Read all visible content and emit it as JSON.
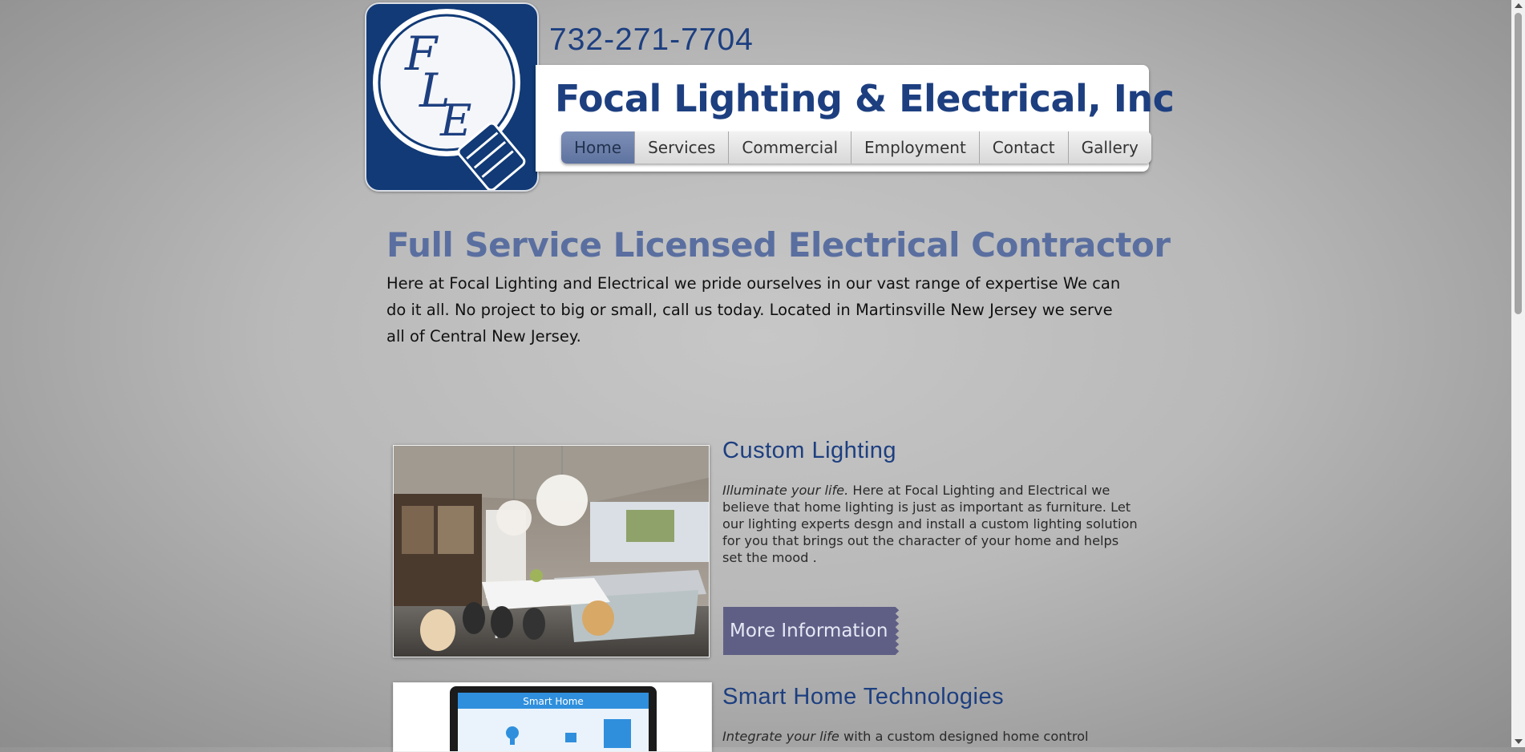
{
  "header": {
    "phone": "732-271-7704",
    "title": "Focal Lighting & Electrical, Inc",
    "logo_initials": [
      "F",
      "L",
      "E"
    ]
  },
  "nav": {
    "items": [
      {
        "label": "Home",
        "active": true
      },
      {
        "label": "Services",
        "active": false
      },
      {
        "label": "Commercial",
        "active": false
      },
      {
        "label": "Employment",
        "active": false
      },
      {
        "label": "Contact",
        "active": false
      },
      {
        "label": "Gallery",
        "active": false
      }
    ]
  },
  "intro": {
    "headline": "Full Service Licensed Electrical Contractor",
    "body": "Here at Focal Lighting and Electrical we pride ourselves in our vast range of expertise We can do it all. No project to big or small, call us today.  Located in Martinsville New Jersey we serve all of Central New Jersey."
  },
  "features": [
    {
      "title": "Custom Lighting",
      "lead": "Illuminate your life.",
      "text": " Here at Focal Lighting and Electrical we believe that home lighting is just as important as furniture. Let our lighting experts desgn and install a custom lighting solution for you that brings out the character of your home and helps set the mood .",
      "button": "More Information"
    },
    {
      "title": "Smart Home Technologies",
      "lead": "Integrate your life",
      "text": " with a custom designed home control",
      "screen_title": "Smart Home"
    }
  ],
  "colors": {
    "brand_navy": "#1d3f80",
    "headline_blue": "#5a6fa0",
    "nav_active": "#6a7fab",
    "button_purple": "#5f5f86"
  }
}
